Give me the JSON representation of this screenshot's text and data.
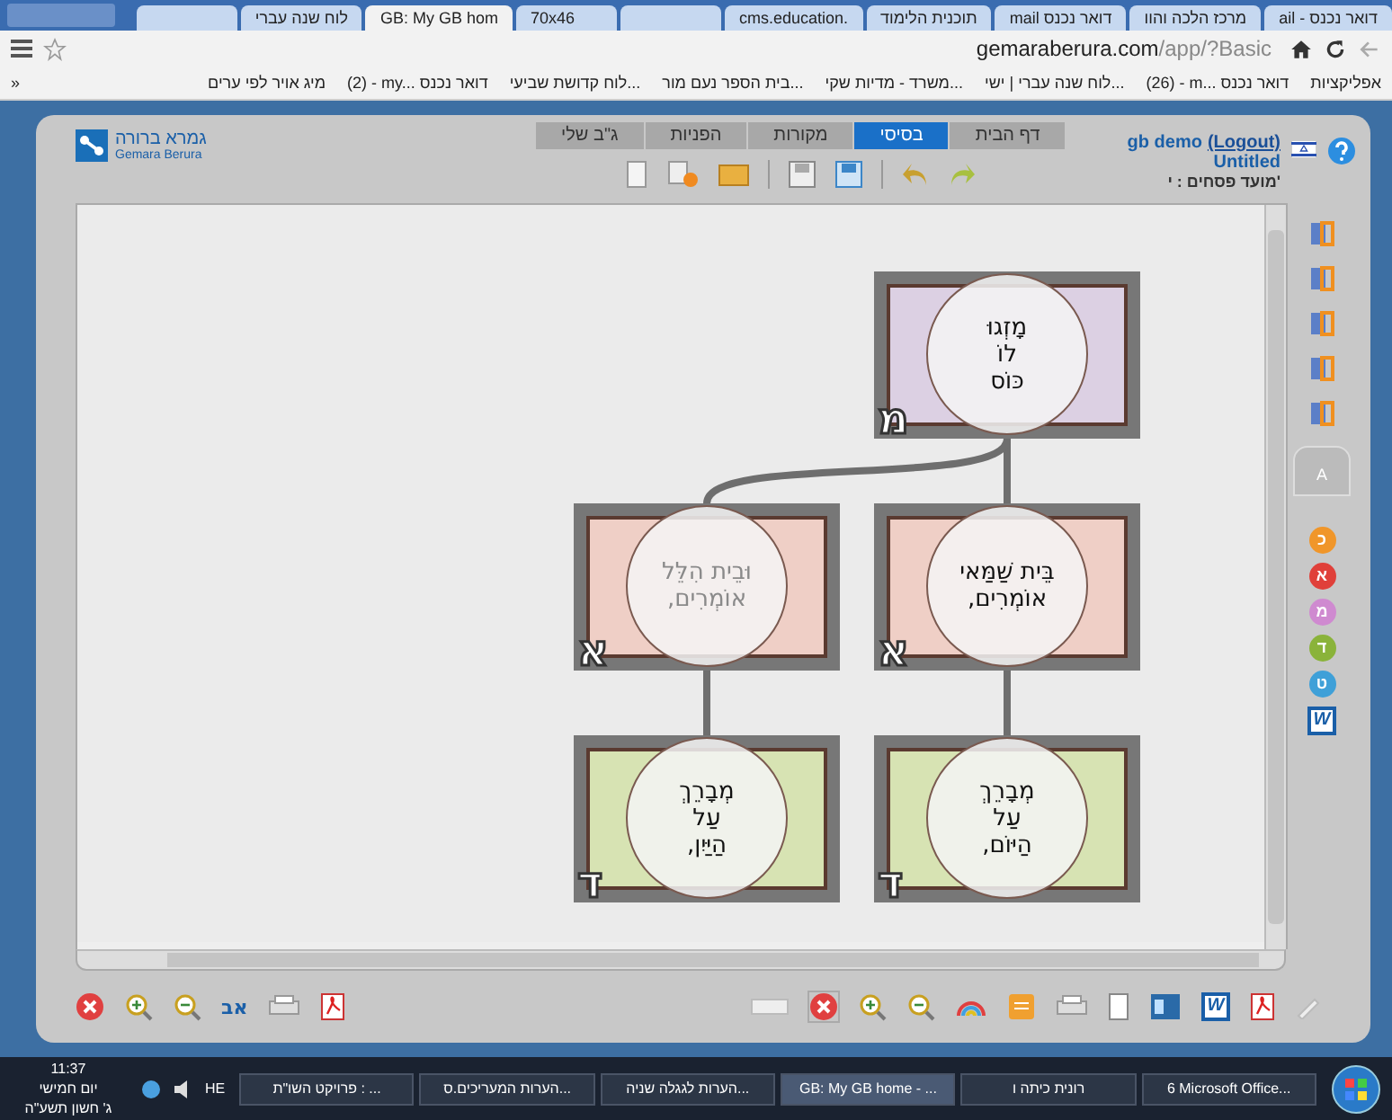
{
  "browser": {
    "tabs": [
      {
        "label": "ail - דואר נכנס",
        "selected": false
      },
      {
        "label": "מרכז הלכה והוו",
        "selected": false
      },
      {
        "label": "mail דואר נכנס",
        "selected": false
      },
      {
        "label": "תוכנית הלימוד",
        "selected": false
      },
      {
        "label": "cms.education.",
        "selected": false
      },
      {
        "selected": false
      },
      {
        "label": "70x46",
        "selected": false
      },
      {
        "label": "GB: My GB hom",
        "selected": true
      },
      {
        "label": "לוח שנה עברי",
        "selected": false
      },
      {
        "selected": false
      }
    ],
    "url_host": "gemaraberura.com",
    "url_path": "/app/?Basic",
    "bookmarks_more": "»",
    "bookmarks": [
      "אפליקציות",
      "(26) - m... דואר נכנס",
      "לוח שנה עברי | ישי...",
      "משרד - מדיות שקי...",
      "בית הספר נעם מור...",
      "לוח קדושת שביעי...",
      "(2) - my... דואר נכנס",
      "מיג אויר לפי ערים"
    ]
  },
  "app": {
    "logo": {
      "title": "גמרא ברורה",
      "subtitle": "Gemara Berura"
    },
    "tabs": [
      {
        "label": "דף הבית",
        "selected": false
      },
      {
        "label": "בסיסי",
        "selected": true
      },
      {
        "label": "מקורות",
        "selected": false
      },
      {
        "label": "הפניות",
        "selected": false
      },
      {
        "label": "ג\"ב שלי",
        "selected": false
      }
    ],
    "user": "gb demo",
    "logout": "(Logout)",
    "document": "Untitled",
    "location": "מועד פסחים : י'",
    "diagram": {
      "root": {
        "lines": [
          "מָזְגוּ",
          "לוֹ",
          "כּוֹס"
        ],
        "letter": "מ",
        "color": "#dcd0e3",
        "faded": false,
        "children": [
          {
            "lines": [
              "בֵּית שַׁמַּאי",
              "אוֹמְרִים,"
            ],
            "letter": "א",
            "color": "#efcfc6",
            "faded": false,
            "children": [
              {
                "lines": [
                  "מְבָרֵךְ",
                  "עַל",
                  "הַיּוֹם,"
                ],
                "letter": "ד",
                "color": "#d7e3b3",
                "faded": false
              }
            ]
          },
          {
            "lines": [
              "וּבֵית הִלֵּל",
              "אוֹמְרִים,"
            ],
            "letter": "א",
            "color": "#efcfc6",
            "faded": true,
            "children": [
              {
                "lines": [
                  "מְבָרֵךְ",
                  "עַל",
                  "הַיַּיִן,"
                ],
                "letter": "ד",
                "color": "#d7e3b3",
                "faded": false
              }
            ]
          }
        ]
      }
    },
    "side_tab": "A",
    "side_badges": [
      {
        "letter": "כ",
        "color": "#f0962a"
      },
      {
        "letter": "א",
        "color": "#e0403a"
      },
      {
        "letter": "מ",
        "color": "#cf8ad0"
      },
      {
        "letter": "ד",
        "color": "#8ab33a"
      },
      {
        "letter": "ט",
        "color": "#3fa0d8"
      }
    ],
    "word_badge": "W",
    "bottom_word": "W",
    "alef_bet": "אב"
  },
  "taskbar": {
    "time": "11:37",
    "day": "יום חמישי",
    "date": "ג' חשון תשע\"ה",
    "lang": "HE",
    "tasks": [
      {
        "label": "6 Microsoft Office...",
        "selected": false
      },
      {
        "label": "רונית כיתה ו",
        "selected": false
      },
      {
        "label": "GB: My GB home - ...",
        "selected": true
      },
      {
        "label": "הערות לגגלה שניה...",
        "selected": false
      },
      {
        "label": "הערות המעריכים.ס...",
        "selected": false
      },
      {
        "label": "פרויקט השו\"ת : ...",
        "selected": false
      }
    ]
  }
}
